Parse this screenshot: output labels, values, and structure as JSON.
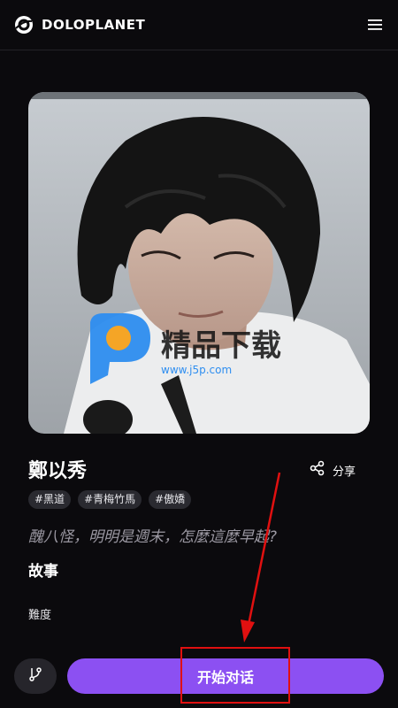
{
  "header": {
    "brand": "DOLOPLANET",
    "logo_icon": "planet-logo-icon",
    "menu_icon": "hamburger-menu-icon"
  },
  "character": {
    "name": "鄭以秀",
    "tags": [
      "#黑道",
      "#青梅竹馬",
      "#傲嬌"
    ],
    "quote": "醜八怪，明明是週末，怎麼這麼早起?"
  },
  "watermark": {
    "text": "精品下载",
    "url": "www.j5p.com"
  },
  "share": {
    "label": "分享",
    "icon": "share-icon"
  },
  "sections": {
    "story": "故事",
    "difficulty": "難度"
  },
  "actions": {
    "start_chat": "开始对话",
    "branch_icon": "branch-icon"
  },
  "colors": {
    "background": "#0b0a0d",
    "accent": "#8c50f2",
    "annotation": "#e01010"
  }
}
